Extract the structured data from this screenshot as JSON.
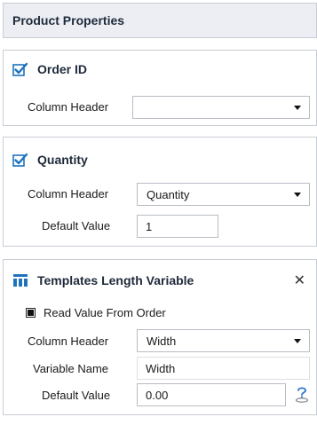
{
  "header": {
    "title": "Product Properties"
  },
  "order_id_panel": {
    "title": "Order ID",
    "column_header_label": "Column Header",
    "column_header_value": ""
  },
  "quantity_panel": {
    "title": "Quantity",
    "column_header_label": "Column Header",
    "column_header_value": "Quantity",
    "default_value_label": "Default Value",
    "default_value": "1"
  },
  "length_panel": {
    "title": "Templates Length Variable",
    "close_glyph": "✕",
    "read_value_label": "Read Value From Order",
    "column_header_label": "Column Header",
    "column_header_value": "Width",
    "variable_name_label": "Variable Name",
    "variable_name_value": "Width",
    "default_value_label": "Default Value",
    "default_value": "0.00"
  },
  "colors": {
    "accent_blue": "#1e73be",
    "header_bg": "#eceef3",
    "border": "#c9ccd3"
  },
  "icons": {
    "checked": "checkbox-checked-icon",
    "template": "template-variable-icon",
    "help": "help-icon"
  }
}
